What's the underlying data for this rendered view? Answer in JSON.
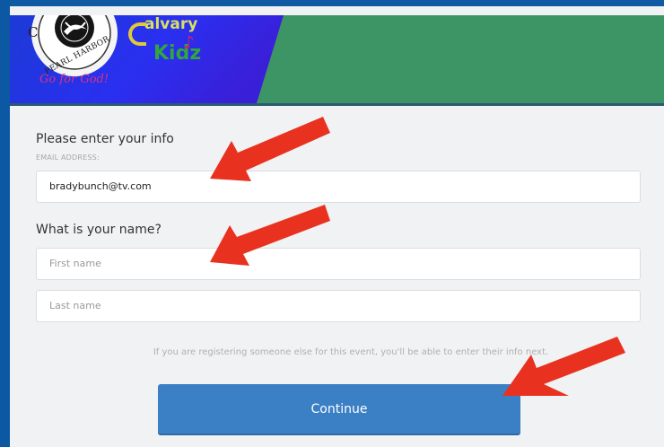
{
  "banner": {
    "logo_text_arc_top": "C",
    "logo_text_arc_bottom": "PEARL HARBOR",
    "tagline": "Go for God!",
    "ministry_name_line1": "alvary",
    "ministry_name_line2": "Kidz",
    "colors": {
      "blue": "#1f3fd8",
      "green": "#3d9566",
      "accent_pink": "#d4286e"
    }
  },
  "form": {
    "heading_info": "Please enter your info",
    "email_label": "EMAIL ADDRESS:",
    "email_value": "bradybunch@tv.com",
    "heading_name": "What is your name?",
    "first_name_placeholder": "First name",
    "last_name_placeholder": "Last name",
    "note": "If you are registering someone else for this event, you'll be able to enter their info next.",
    "continue_label": "Continue"
  },
  "annotations": {
    "arrow_color": "#e8321f",
    "arrow_icons": [
      "arrow-to-email-icon",
      "arrow-to-name-icon",
      "arrow-to-continue-icon"
    ]
  }
}
